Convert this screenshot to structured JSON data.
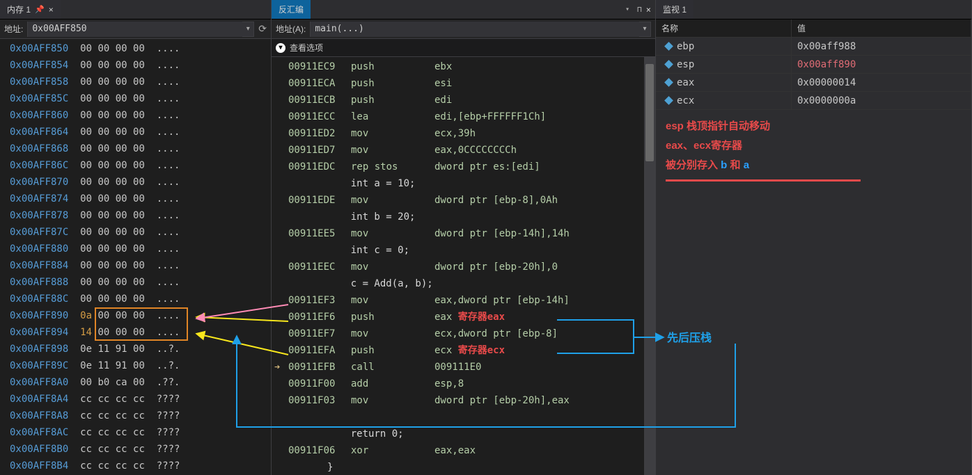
{
  "memory_panel": {
    "title": "内存 1",
    "addr_label": "地址:",
    "addr_value": "0x00AFF850",
    "rows": [
      {
        "addr": "0x00AFF850",
        "bytes": [
          "00",
          "00",
          "00",
          "00"
        ],
        "ascii": "....",
        "hot": []
      },
      {
        "addr": "0x00AFF854",
        "bytes": [
          "00",
          "00",
          "00",
          "00"
        ],
        "ascii": "....",
        "hot": []
      },
      {
        "addr": "0x00AFF858",
        "bytes": [
          "00",
          "00",
          "00",
          "00"
        ],
        "ascii": "....",
        "hot": []
      },
      {
        "addr": "0x00AFF85C",
        "bytes": [
          "00",
          "00",
          "00",
          "00"
        ],
        "ascii": "....",
        "hot": []
      },
      {
        "addr": "0x00AFF860",
        "bytes": [
          "00",
          "00",
          "00",
          "00"
        ],
        "ascii": "....",
        "hot": []
      },
      {
        "addr": "0x00AFF864",
        "bytes": [
          "00",
          "00",
          "00",
          "00"
        ],
        "ascii": "....",
        "hot": []
      },
      {
        "addr": "0x00AFF868",
        "bytes": [
          "00",
          "00",
          "00",
          "00"
        ],
        "ascii": "....",
        "hot": []
      },
      {
        "addr": "0x00AFF86C",
        "bytes": [
          "00",
          "00",
          "00",
          "00"
        ],
        "ascii": "....",
        "hot": []
      },
      {
        "addr": "0x00AFF870",
        "bytes": [
          "00",
          "00",
          "00",
          "00"
        ],
        "ascii": "....",
        "hot": []
      },
      {
        "addr": "0x00AFF874",
        "bytes": [
          "00",
          "00",
          "00",
          "00"
        ],
        "ascii": "....",
        "hot": []
      },
      {
        "addr": "0x00AFF878",
        "bytes": [
          "00",
          "00",
          "00",
          "00"
        ],
        "ascii": "....",
        "hot": []
      },
      {
        "addr": "0x00AFF87C",
        "bytes": [
          "00",
          "00",
          "00",
          "00"
        ],
        "ascii": "....",
        "hot": []
      },
      {
        "addr": "0x00AFF880",
        "bytes": [
          "00",
          "00",
          "00",
          "00"
        ],
        "ascii": "....",
        "hot": []
      },
      {
        "addr": "0x00AFF884",
        "bytes": [
          "00",
          "00",
          "00",
          "00"
        ],
        "ascii": "....",
        "hot": []
      },
      {
        "addr": "0x00AFF888",
        "bytes": [
          "00",
          "00",
          "00",
          "00"
        ],
        "ascii": "....",
        "hot": []
      },
      {
        "addr": "0x00AFF88C",
        "bytes": [
          "00",
          "00",
          "00",
          "00"
        ],
        "ascii": "....",
        "hot": []
      },
      {
        "addr": "0x00AFF890",
        "bytes": [
          "0a",
          "00",
          "00",
          "00"
        ],
        "ascii": "....",
        "hot": [
          0
        ]
      },
      {
        "addr": "0x00AFF894",
        "bytes": [
          "14",
          "00",
          "00",
          "00"
        ],
        "ascii": "....",
        "hot": [
          0
        ]
      },
      {
        "addr": "0x00AFF898",
        "bytes": [
          "0e",
          "11",
          "91",
          "00"
        ],
        "ascii": "..?.",
        "hot": []
      },
      {
        "addr": "0x00AFF89C",
        "bytes": [
          "0e",
          "11",
          "91",
          "00"
        ],
        "ascii": "..?.",
        "hot": []
      },
      {
        "addr": "0x00AFF8A0",
        "bytes": [
          "00",
          "b0",
          "ca",
          "00"
        ],
        "ascii": ".??.",
        "hot": []
      },
      {
        "addr": "0x00AFF8A4",
        "bytes": [
          "cc",
          "cc",
          "cc",
          "cc"
        ],
        "ascii": "????",
        "hot": []
      },
      {
        "addr": "0x00AFF8A8",
        "bytes": [
          "cc",
          "cc",
          "cc",
          "cc"
        ],
        "ascii": "????",
        "hot": []
      },
      {
        "addr": "0x00AFF8AC",
        "bytes": [
          "cc",
          "cc",
          "cc",
          "cc"
        ],
        "ascii": "????",
        "hot": []
      },
      {
        "addr": "0x00AFF8B0",
        "bytes": [
          "cc",
          "cc",
          "cc",
          "cc"
        ],
        "ascii": "????",
        "hot": []
      },
      {
        "addr": "0x00AFF8B4",
        "bytes": [
          "cc",
          "cc",
          "cc",
          "cc"
        ],
        "ascii": "????",
        "hot": []
      }
    ]
  },
  "disasm_panel": {
    "title": "反汇编",
    "addr_label": "地址(A):",
    "addr_value": "main(...)",
    "options_label": "查看选项",
    "rows": [
      {
        "type": "asm",
        "addr": "00911EC9",
        "mnem": "push",
        "ops": "ebx"
      },
      {
        "type": "asm",
        "addr": "00911ECA",
        "mnem": "push",
        "ops": "esi"
      },
      {
        "type": "asm",
        "addr": "00911ECB",
        "mnem": "push",
        "ops": "edi"
      },
      {
        "type": "asm",
        "addr": "00911ECC",
        "mnem": "lea",
        "ops": "edi,[ebp+FFFFFF1Ch]"
      },
      {
        "type": "asm",
        "addr": "00911ED2",
        "mnem": "mov",
        "ops": "ecx,39h"
      },
      {
        "type": "asm",
        "addr": "00911ED7",
        "mnem": "mov",
        "ops": "eax,0CCCCCCCCh"
      },
      {
        "type": "asm",
        "addr": "00911EDC",
        "mnem": "rep stos",
        "ops": "dword ptr es:[edi]"
      },
      {
        "type": "src",
        "text": "    int a = 10;"
      },
      {
        "type": "asm",
        "addr": "00911EDE",
        "mnem": "mov",
        "ops": "dword ptr [ebp-8],0Ah"
      },
      {
        "type": "src",
        "text": "    int b = 20;"
      },
      {
        "type": "asm",
        "addr": "00911EE5",
        "mnem": "mov",
        "ops": "dword ptr [ebp-14h],14h"
      },
      {
        "type": "src",
        "text": "    int c = 0;"
      },
      {
        "type": "asm",
        "addr": "00911EEC",
        "mnem": "mov",
        "ops": "dword ptr [ebp-20h],0"
      },
      {
        "type": "src",
        "text": "    c = Add(a, b);"
      },
      {
        "type": "asm",
        "addr": "00911EF3",
        "mnem": "mov",
        "ops": "eax,dword ptr [ebp-14h]"
      },
      {
        "type": "asm",
        "addr": "00911EF6",
        "mnem": "push",
        "ops": "eax",
        "anno": " 寄存器eax"
      },
      {
        "type": "asm",
        "addr": "00911EF7",
        "mnem": "mov",
        "ops": "ecx,dword ptr [ebp-8]"
      },
      {
        "type": "asm",
        "addr": "00911EFA",
        "mnem": "push",
        "ops": "ecx",
        "anno": " 寄存器ecx"
      },
      {
        "type": "asm",
        "addr": "00911EFB",
        "mnem": "call",
        "ops": "009111E0",
        "cur": true
      },
      {
        "type": "asm",
        "addr": "00911F00",
        "mnem": "add",
        "ops": "esp,8"
      },
      {
        "type": "asm",
        "addr": "00911F03",
        "mnem": "mov",
        "ops": "dword ptr [ebp-20h],eax"
      },
      {
        "type": "blank"
      },
      {
        "type": "src",
        "text": "    return 0;"
      },
      {
        "type": "asm",
        "addr": "00911F06",
        "mnem": "xor",
        "ops": "eax,eax"
      },
      {
        "type": "src",
        "text": "}"
      }
    ]
  },
  "watch_panel": {
    "title": "监视 1",
    "col_name": "名称",
    "col_val": "值",
    "rows": [
      {
        "name": "ebp",
        "val": "0x00aff988",
        "changed": false
      },
      {
        "name": "esp",
        "val": "0x00aff890",
        "changed": true
      },
      {
        "name": "eax",
        "val": "0x00000014",
        "changed": false
      },
      {
        "name": "ecx",
        "val": "0x0000000a",
        "changed": false
      }
    ],
    "notes": {
      "l1_a": "esp",
      "l1_b": " 栈顶指针自动移动",
      "l2": "eax、ecx寄存器",
      "l3_a": "被分别存入 ",
      "l3_b": "b",
      "l3_c": " 和 ",
      "l3_d": "a"
    },
    "arrow_label": "先后压栈"
  }
}
